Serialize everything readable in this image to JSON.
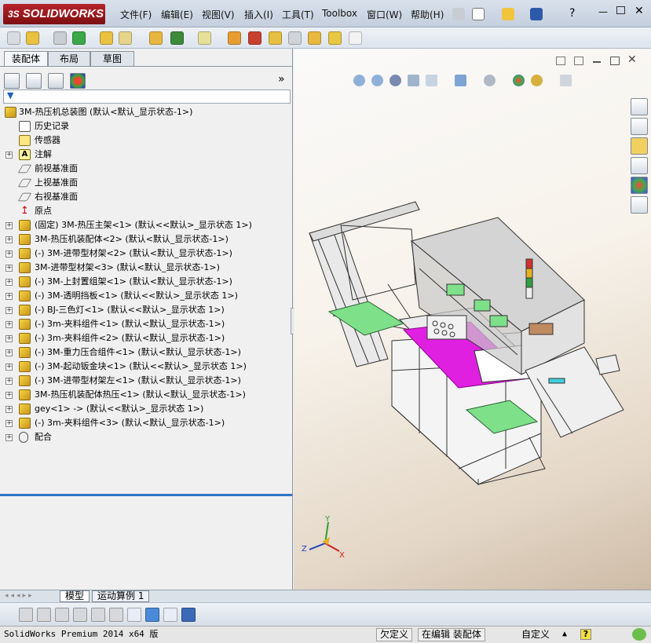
{
  "app": {
    "logo_prefix": "3S",
    "logo_text": "SOLIDWORKS"
  },
  "menu": [
    "文件(F)",
    "编辑(E)",
    "视图(V)",
    "插入(I)",
    "工具(T)",
    "Toolbox",
    "窗口(W)",
    "帮助(H)"
  ],
  "left_tabs": [
    "装配体",
    "布局",
    "草图"
  ],
  "expand_glyph": "»",
  "tree": [
    {
      "label": "3M-热压机总装图  (默认<默认_显示状态-1>)",
      "icon": "assembly-icon",
      "exp": false
    },
    {
      "label": "历史记录",
      "icon": "history-icon",
      "exp": false
    },
    {
      "label": "传感器",
      "icon": "sensor-icon",
      "exp": false
    },
    {
      "label": "注解",
      "icon": "annotation-icon",
      "exp": true
    },
    {
      "label": "前视基准面",
      "icon": "plane-icon",
      "exp": false
    },
    {
      "label": "上视基准面",
      "icon": "plane-icon",
      "exp": false
    },
    {
      "label": "右视基准面",
      "icon": "plane-icon",
      "exp": false
    },
    {
      "label": "原点",
      "icon": "origin-icon",
      "exp": false
    },
    {
      "label": "(固定) 3M-热压主架<1> (默认<<默认>_显示状态 1>)",
      "icon": "assembly-icon",
      "exp": true
    },
    {
      "label": "3M-热压机装配体<2> (默认<默认_显示状态-1>)",
      "icon": "assembly-icon",
      "exp": true
    },
    {
      "label": "(-) 3M-进带型材架<2> (默认<默认_显示状态-1>)",
      "icon": "assembly-icon",
      "exp": true
    },
    {
      "label": "3M-进带型材架<3> (默认<默认_显示状态-1>)",
      "icon": "assembly-icon",
      "exp": true
    },
    {
      "label": "(-) 3M-上封置组架<1> (默认<默认_显示状态-1>)",
      "icon": "assembly-icon",
      "exp": true
    },
    {
      "label": "(-) 3M-透明挡板<1> (默认<<默认>_显示状态 1>)",
      "icon": "assembly-icon",
      "exp": true
    },
    {
      "label": "(-) BJ-三色灯<1> (默认<<默认>_显示状态 1>)",
      "icon": "assembly-icon",
      "exp": true
    },
    {
      "label": "(-) 3m-夹料组件<1> (默认<默认_显示状态-1>)",
      "icon": "assembly-icon",
      "exp": true
    },
    {
      "label": "(-) 3m-夹料组件<2> (默认<默认_显示状态-1>)",
      "icon": "assembly-icon",
      "exp": true
    },
    {
      "label": "(-) 3M-重力压合组件<1> (默认<默认_显示状态-1>)",
      "icon": "assembly-icon",
      "exp": true
    },
    {
      "label": "(-) 3M-起动钣金块<1> (默认<<默认>_显示状态 1>)",
      "icon": "assembly-icon",
      "exp": true
    },
    {
      "label": "(-) 3M-进带型材架左<1> (默认<默认_显示状态-1>)",
      "icon": "assembly-icon",
      "exp": true
    },
    {
      "label": "3M-热压机装配体热压<1> (默认<默认_显示状态-1>)",
      "icon": "assembly-icon",
      "exp": true
    },
    {
      "label": "gey<1> -> (默认<<默认>_显示状态 1>)",
      "icon": "assembly-icon",
      "exp": true
    },
    {
      "label": "(-) 3m-夹料组件<3> (默认<默认_显示状态-1>)",
      "icon": "assembly-icon",
      "exp": true
    },
    {
      "label": "配合",
      "icon": "mates-icon",
      "exp": true
    }
  ],
  "triad": {
    "x": "X",
    "y": "Y",
    "z": "Z"
  },
  "bottom_tabs": [
    "模型",
    "运动算例 1"
  ],
  "status": {
    "product": "SolidWorks Premium 2014 x64 版",
    "state": "欠定义",
    "mode": "在编辑 装配体",
    "units": "自定义",
    "help": "?"
  },
  "colors": {
    "brand": "#b8242a",
    "accent": "#2f74c8",
    "magenta": "#e020e0",
    "green": "#7fe08a"
  }
}
